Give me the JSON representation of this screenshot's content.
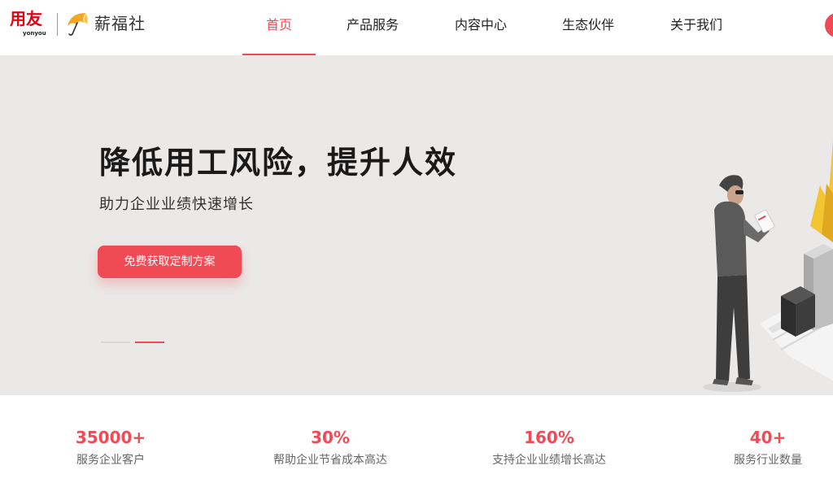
{
  "header": {
    "logo_yonyou_cn": "用友",
    "logo_yonyou_en": "yonyou",
    "logo_brand": "薪福社",
    "nav": [
      {
        "label": "首页"
      },
      {
        "label": "产品服务"
      },
      {
        "label": "内容中心"
      },
      {
        "label": "生态伙伴"
      },
      {
        "label": "关于我们"
      }
    ],
    "active_nav": "首页"
  },
  "hero": {
    "title": "降低用工风险，提升人效",
    "subtitle": "助力企业业绩快速增长",
    "cta_label": "免费获取定制方案",
    "carousel_count": 2,
    "carousel_active": 2
  },
  "stats": [
    {
      "value": "35000+",
      "label": "服务企业客户"
    },
    {
      "value": "30%",
      "label": "帮助企业节省成本高达"
    },
    {
      "value": "160%",
      "label": "支持企业业绩增长高达"
    },
    {
      "value": "40+",
      "label": "服务行业数量"
    }
  ],
  "colors": {
    "accent": "#f04a55",
    "hero_bg": "#ebe9e8",
    "logo_red": "#e60012"
  }
}
